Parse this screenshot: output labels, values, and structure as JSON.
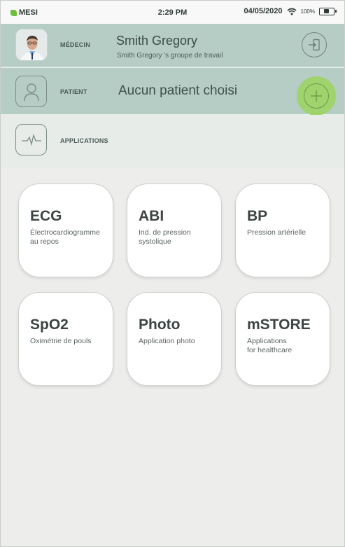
{
  "status_bar": {
    "carrier": "MESI",
    "time": "2:29 PM",
    "date": "04/05/2020",
    "battery": "100%",
    "accent_color": "#6bbf3a"
  },
  "medecin": {
    "label": "MÉDECIN",
    "name": "Smith Gregory",
    "group": "Smith Gregory 's groupe de travail",
    "logout_icon": "logout-icon"
  },
  "patient": {
    "label": "PATIENT",
    "value": "Aucun patient choisi",
    "icon": "person-icon",
    "add_icon": "plus-icon",
    "add_color": "#9fd36d"
  },
  "applications": {
    "label": "APPLICATIONS",
    "icon": "ecg-wave-icon"
  },
  "tiles": [
    {
      "title": "ECG",
      "subtitle": "Électrocardiogramme\nau repos"
    },
    {
      "title": "ABI",
      "subtitle": "Ind. de pression\nsystolique"
    },
    {
      "title": "BP",
      "subtitle": "Pression artérielle"
    },
    {
      "title": "SpO2",
      "subtitle": "Oximétrie de pouls"
    },
    {
      "title": "Photo",
      "subtitle": "Application photo"
    },
    {
      "title": "mSTORE",
      "subtitle": "Applications\nfor healthcare"
    }
  ]
}
